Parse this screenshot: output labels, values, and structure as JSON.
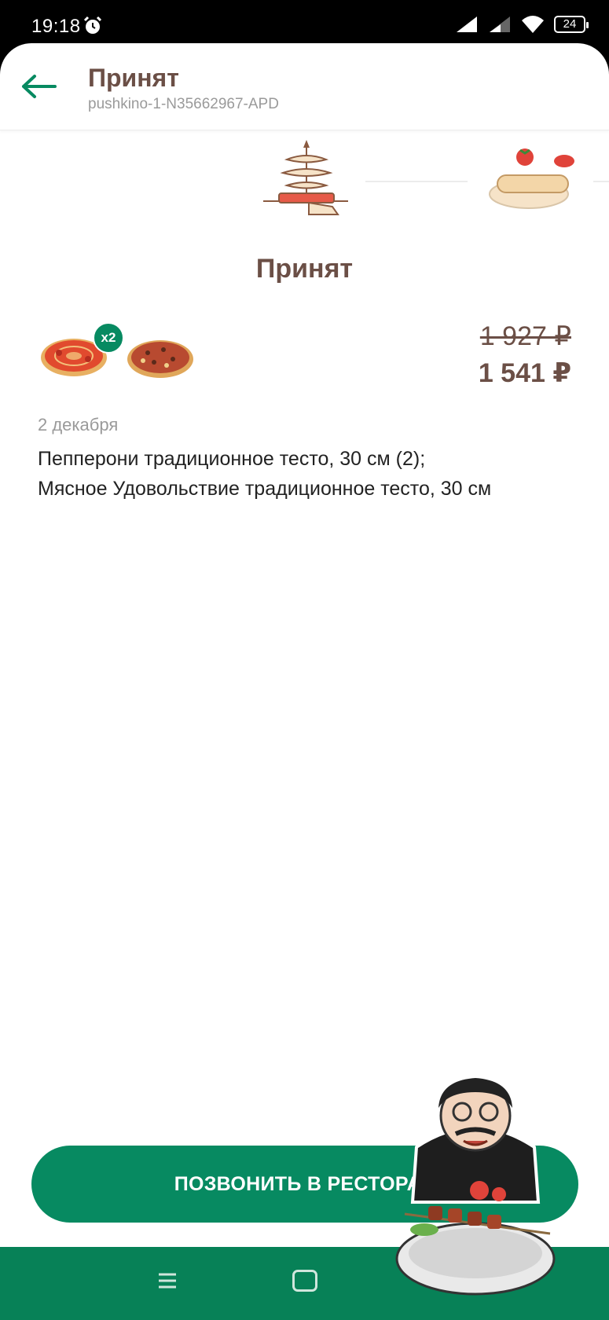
{
  "status_bar": {
    "time": "19:18",
    "battery": "24",
    "icons": [
      "alarm-icon",
      "cell-signal-icon",
      "cell-signal-weak-icon",
      "wifi-icon",
      "battery-icon"
    ]
  },
  "header": {
    "back_icon": "arrow-left-icon",
    "title": "Принят",
    "order_id": "pushkino-1-N35662967-APD"
  },
  "stages": {
    "current_label": "Принят",
    "icons": [
      "order-accepted-stage-icon",
      "dough-preparation-stage-icon"
    ]
  },
  "order": {
    "products": [
      {
        "icon": "pepperoni-pizza-icon",
        "quantity_badge": "x2"
      },
      {
        "icon": "meat-pizza-icon"
      }
    ],
    "price_old": "1 927 ₽",
    "price_new": "1 541 ₽",
    "date": "2 декабря",
    "items": [
      "Пепперони традиционное тесто, 30 см (2);",
      "Мясное Удовольствие традиционное тесто, 30 см"
    ]
  },
  "actions": {
    "call_restaurant": "ПОЗВОНИТЬ В РЕСТОРАН"
  },
  "nav_bar": {
    "icons": [
      "menu-icon",
      "home-icon"
    ]
  },
  "colors": {
    "accent": "#078a61",
    "nav_bar": "#078157",
    "brand_text": "#6b4f46",
    "muted_text": "#9a9a9a"
  }
}
